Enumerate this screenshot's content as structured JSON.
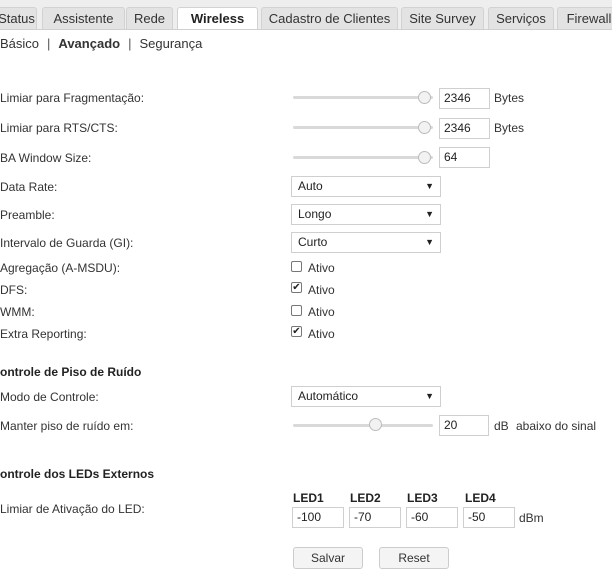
{
  "tabs": [
    "Status",
    "Assistente",
    "Rede",
    "Wireless",
    "Cadastro de Clientes",
    "Site Survey",
    "Serviços",
    "Firewall"
  ],
  "subnav": {
    "basic": "Básico",
    "separator": "|",
    "advanced": "Avançado",
    "security": "Segurança"
  },
  "fragmentation": {
    "label": "Limiar para Fragmentação:",
    "value": "2346",
    "unit": "Bytes"
  },
  "rts_cts": {
    "label": "Limiar para RTS/CTS:",
    "value": "2346",
    "unit": "Bytes"
  },
  "ba_window": {
    "label": "BA Window Size:",
    "value": "64"
  },
  "data_rate": {
    "label": "Data Rate:",
    "selected": "Auto"
  },
  "preamble": {
    "label": "Preamble:",
    "selected": "Longo"
  },
  "guard_interval": {
    "label": "Intervalo de Guarda (GI):",
    "selected": "Curto"
  },
  "amsdu": {
    "label": "Agregação (A-MSDU):",
    "option": "Ativo",
    "checked": false
  },
  "dfs": {
    "label": "DFS:",
    "option": "Ativo",
    "checked": true
  },
  "wmm": {
    "label": "WMM:",
    "option": "Ativo",
    "checked": false
  },
  "extra_reporting": {
    "label": "Extra Reporting:",
    "option": "Ativo",
    "checked": true
  },
  "noise_floor": {
    "heading": "ontrole de Piso de Ruído",
    "mode_label": "Modo de Controle:",
    "mode_selected": "Automático",
    "keep_label": "Manter piso de ruído em:",
    "value": "20",
    "unit": "dB",
    "suffix": "abaixo do sinal"
  },
  "leds": {
    "heading": "ontrole dos LEDs Externos",
    "label": "Limiar de Ativação do LED:",
    "headers": [
      "LED1",
      "LED2",
      "LED3",
      "LED4"
    ],
    "values": [
      "-100",
      "-70",
      "-60",
      "-50"
    ],
    "unit": "dBm"
  },
  "buttons": {
    "save": "Salvar",
    "reset": "Reset"
  },
  "icons": {
    "dropdown": "chevron-down-icon",
    "check": "checkmark-icon"
  }
}
